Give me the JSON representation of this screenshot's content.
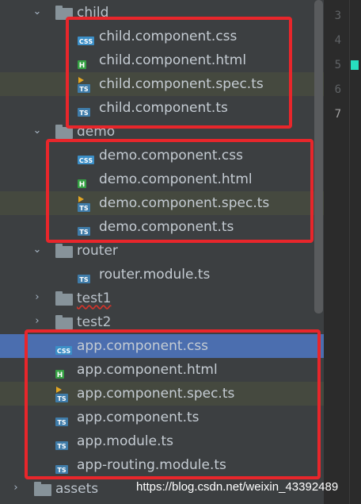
{
  "tree": {
    "child": {
      "folder_label": "child",
      "files": [
        "child.component.css",
        "child.component.html",
        "child.component.spec.ts",
        "child.component.ts"
      ]
    },
    "demo": {
      "folder_label": "demo",
      "files": [
        "demo.component.css",
        "demo.component.html",
        "demo.component.spec.ts",
        "demo.component.ts"
      ]
    },
    "router": {
      "folder_label": "router",
      "files": [
        "router.module.ts"
      ]
    },
    "test1": {
      "folder_label": "test1"
    },
    "test2": {
      "folder_label": "test2"
    },
    "app_files": [
      "app.component.css",
      "app.component.html",
      "app.component.spec.ts",
      "app.component.ts",
      "app.module.ts",
      "app-routing.module.ts"
    ],
    "assets": {
      "folder_label": "assets"
    }
  },
  "file_types": {
    "css": {
      "badge": "CSS",
      "color": "#3c8fc7"
    },
    "html": {
      "badge": "H",
      "color": "#35a143"
    },
    "ts": {
      "badge": "TS",
      "color": "#3f7ca9"
    },
    "spec": {
      "badge": "TS",
      "color": "#3f7ca9",
      "accent": "#e3a623"
    }
  },
  "editor": {
    "line_numbers": [
      "3",
      "4",
      "5",
      "6",
      "7"
    ],
    "current_line": "7"
  },
  "colors": {
    "selection": "#4b6eaf",
    "highlight_box": "#e8262b",
    "change_marker": "#27e0c0"
  },
  "watermark": "https://blog.csdn.net/weixin_43392489"
}
